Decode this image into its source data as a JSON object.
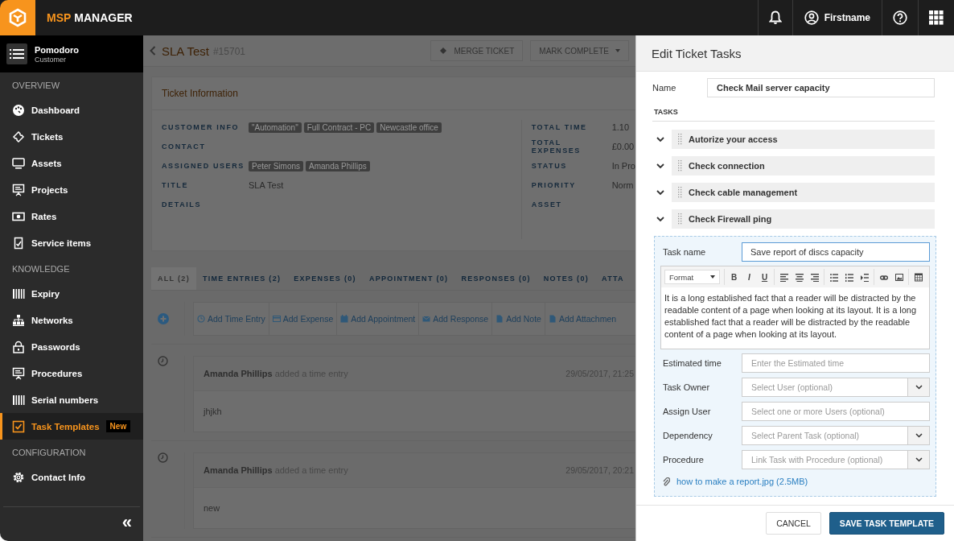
{
  "topbar": {
    "brand_prefix": "MSP",
    "brand_name": "MANAGER",
    "user": "Firstname"
  },
  "sidebar": {
    "customer": {
      "name": "Pomodoro",
      "type": "Customer"
    },
    "sections": [
      {
        "title": "OVERVIEW",
        "items": [
          {
            "label": "Dashboard",
            "selected": false
          },
          {
            "label": "Tickets",
            "selected": false
          },
          {
            "label": "Assets",
            "selected": false
          },
          {
            "label": "Projects",
            "selected": false
          },
          {
            "label": "Rates",
            "selected": false
          },
          {
            "label": "Service items",
            "selected": false
          }
        ]
      },
      {
        "title": "KNOWLEDGE",
        "items": [
          {
            "label": "Expiry",
            "selected": false
          },
          {
            "label": "Networks",
            "selected": false
          },
          {
            "label": "Passwords",
            "selected": false
          },
          {
            "label": "Procedures",
            "selected": false
          },
          {
            "label": "Serial numbers",
            "selected": false
          },
          {
            "label": "Task Templates",
            "selected": true,
            "badge": "New"
          }
        ]
      },
      {
        "title": "CONFIGURATION",
        "items": [
          {
            "label": "Contact Info",
            "selected": false
          }
        ]
      }
    ],
    "collapse": "«"
  },
  "ticket": {
    "title": "SLA Test",
    "number": "#15701",
    "buttons": [
      "MERGE TICKET",
      "MARK COMPLETE"
    ],
    "card_title": "Ticket Information",
    "left_fields": [
      {
        "label": "CUSTOMER INFO",
        "tags": [
          "\"Automation\"",
          "Full Contract - PC",
          "Newcastle office"
        ]
      },
      {
        "label": "CONTACT"
      },
      {
        "label": "ASSIGNED USERS",
        "tags": [
          "Peter Simons",
          "Amanda Phillips"
        ]
      },
      {
        "label": "TITLE",
        "value": "SLA Test"
      },
      {
        "label": "DETAILS"
      }
    ],
    "right_fields": [
      {
        "label": "TOTAL TIME",
        "value": "1.10"
      },
      {
        "label": "TOTAL EXPENSES",
        "value": "£0.00"
      },
      {
        "label": "STATUS",
        "value": "In Pro"
      },
      {
        "label": "PRIORITY",
        "value": "Norm"
      },
      {
        "label": "ASSET"
      }
    ],
    "tabs": [
      {
        "label": "ALL (2)",
        "selected": true
      },
      {
        "label": "TIME ENTRIES (2)",
        "selected": false
      },
      {
        "label": "EXPENSES (0)",
        "selected": false
      },
      {
        "label": "APPOINTMENT (0)",
        "selected": false
      },
      {
        "label": "RESPONSES (0)",
        "selected": false
      },
      {
        "label": "NOTES (0)",
        "selected": false
      },
      {
        "label": "ATTA",
        "selected": false
      }
    ],
    "actions": [
      "Add Time Entry",
      "Add Expense",
      "Add Appointment",
      "Add Response",
      "Add Note",
      "Add Attachmen"
    ],
    "entries": [
      {
        "header": "**Amanda Phillips** added a time entry",
        "date": "29/05/2017, 21:25",
        "body": "jhjkh"
      },
      {
        "header": "**Amanda Phillips** added a time entry",
        "date": "29/05/2017, 20:21",
        "body": "new"
      }
    ]
  },
  "drawer": {
    "title": "Edit Ticket Tasks",
    "name_label": "Name",
    "name_value": "Check Mail server capacity",
    "tasks_heading": "TASKS",
    "tasks": [
      "Autorize your access",
      "Check connection",
      "Check cable management",
      "Check Firewall ping"
    ],
    "form": {
      "task_name_label": "Task name",
      "task_name_value": "Save report of discs capacity",
      "editor": {
        "format": "Format",
        "text_buttons": [
          "B",
          "I",
          "U"
        ],
        "body": "It is a long established fact that a reader will be distracted by the readable content of a page when looking at its layout. It is a long established fact that a reader will be distracted by the readable content of a page when looking at its layout."
      },
      "fields": [
        {
          "label": "Estimated time",
          "placeholder": "Enter the Estimated time",
          "kind": "input"
        },
        {
          "label": "Task Owner",
          "placeholder": "Select User (optional)",
          "kind": "select"
        },
        {
          "label": "Assign User",
          "placeholder": "Select one or more Users (optional)",
          "kind": "input"
        },
        {
          "label": "Dependency",
          "placeholder": "Select Parent Task (optional)",
          "kind": "select"
        },
        {
          "label": "Procedure",
          "placeholder": "Link Task with Procedure (optional)",
          "kind": "select"
        }
      ],
      "attachments": [
        "how to make a report.jpg (2.5MB)"
      ]
    },
    "buttons": [
      {
        "label": "CANCEL",
        "kind": "secondary"
      },
      {
        "label": "SAVE TASK TEMPLATE",
        "kind": "primary"
      }
    ]
  }
}
